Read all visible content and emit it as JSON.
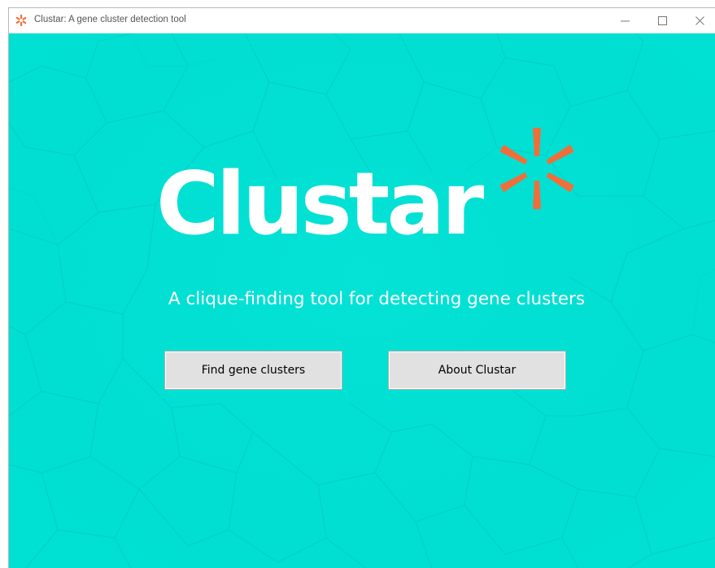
{
  "window": {
    "title": "Clustar: A gene cluster detection tool",
    "icons": {
      "app": "clustar-star-icon",
      "minimize": "minimize-icon",
      "maximize": "maximize-icon",
      "close": "close-icon"
    }
  },
  "hero": {
    "logo_text": "Clustar",
    "tagline": "A clique-finding tool for detecting gene clusters"
  },
  "actions": {
    "find_label": "Find gene clusters",
    "about_label": "About Clustar"
  },
  "colors": {
    "background": "#00e0d3",
    "accent": "#ef6f3b",
    "text": "#ffffff",
    "button": "#e1e1e1"
  }
}
